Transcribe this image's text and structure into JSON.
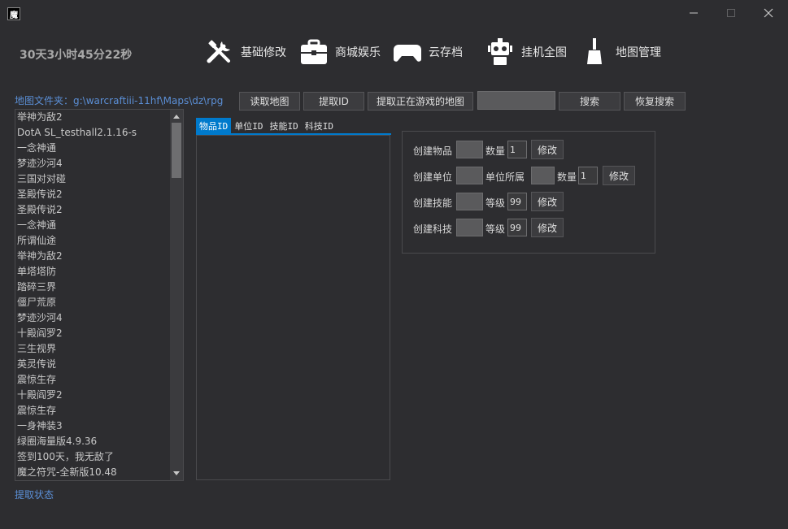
{
  "window": {
    "app_icon_text": "魔",
    "controls": [
      "minimize-icon",
      "maximize-icon",
      "close-icon"
    ]
  },
  "timer": "30天3小时45分22秒",
  "nav": [
    {
      "label": "基础修改",
      "icon": "tools-icon"
    },
    {
      "label": "商城娱乐",
      "icon": "briefcase-icon"
    },
    {
      "label": "云存档",
      "icon": "gamepad-icon"
    },
    {
      "label": "挂机全图",
      "icon": "robot-icon"
    },
    {
      "label": "地图管理",
      "icon": "brush-icon"
    }
  ],
  "folder": {
    "label": "地图文件夹：",
    "path": "g:\\warcraftiii-11hf\\Maps\\dz\\rpg"
  },
  "toolbar": {
    "read_map": "读取地图",
    "extract_id": "提取ID",
    "extract_current": "提取正在游戏的地图",
    "search_value": "",
    "search": "搜索",
    "reset_search": "恢复搜索"
  },
  "map_list": [
    "举神为敌2",
    "DotA SL_testhall2.1.16-s",
    "一念神通",
    "梦迹沙河4",
    "三国对对碰",
    "圣殿传说2",
    "圣殿传说2",
    "一念神通",
    "所谓仙途",
    "举神为敌2",
    "单塔塔防",
    "踏碎三界",
    "僵尸荒原",
    "梦迹沙河4",
    "十殿阎罗2",
    "三生视界",
    "英灵传说",
    "震惊生存",
    "十殿阎罗2",
    "震惊生存",
    "一身神装3",
    "绿圈海量版4.9.36",
    "签到100天，我无敌了",
    "魔之符咒-全新版10.48"
  ],
  "tabs": [
    {
      "label": "物品ID",
      "active": true
    },
    {
      "label": "单位ID",
      "active": false
    },
    {
      "label": "技能ID",
      "active": false
    },
    {
      "label": "科技ID",
      "active": false
    }
  ],
  "create": {
    "item": {
      "label": "创建物品",
      "qty_label": "数量",
      "qty_value": "1",
      "button": "修改"
    },
    "unit": {
      "label": "创建单位",
      "owner_label": "单位所属",
      "qty_label": "数量",
      "qty_value": "1",
      "button": "修改"
    },
    "skill": {
      "label": "创建技能",
      "level_label": "等级",
      "level_value": "99",
      "button": "修改"
    },
    "tech": {
      "label": "创建科技",
      "level_label": "等级",
      "level_value": "99",
      "button": "修改"
    }
  },
  "status": "提取状态",
  "colors": {
    "background": "#2d2d30",
    "accent": "#007acc",
    "link": "#5b8fd6"
  }
}
